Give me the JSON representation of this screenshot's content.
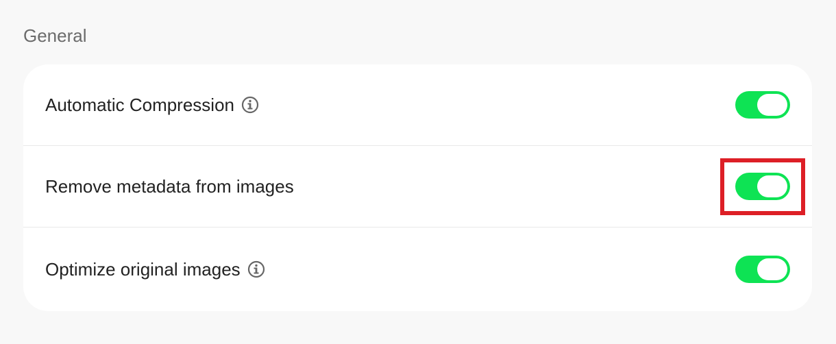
{
  "section": {
    "title": "General"
  },
  "settings": [
    {
      "label": "Automatic Compression",
      "has_info": true,
      "info_icon": "info-circle-icon",
      "enabled": true
    },
    {
      "label": "Remove metadata from images",
      "has_info": false,
      "enabled": true
    },
    {
      "label": "Optimize original images",
      "has_info": true,
      "info_icon": "info-circle-icon",
      "enabled": true
    }
  ],
  "colors": {
    "toggle_on": "#0ee354",
    "highlight": "#dd1f26",
    "background": "#f8f8f8",
    "card": "#ffffff"
  }
}
